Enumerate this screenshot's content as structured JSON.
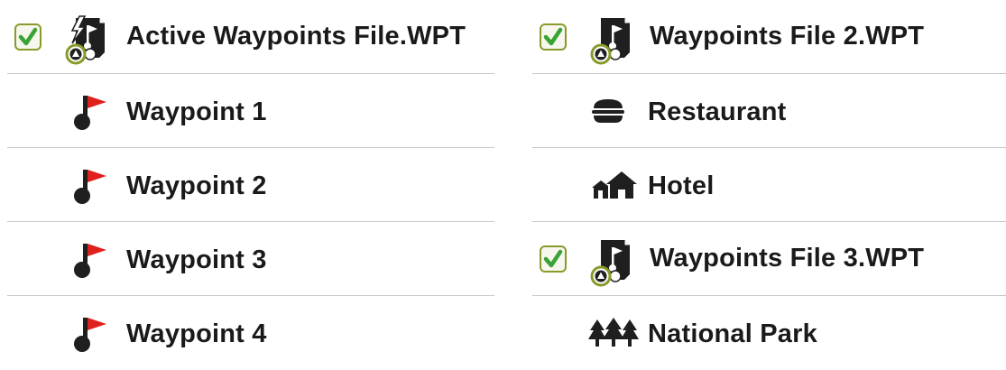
{
  "left_column": {
    "file": {
      "label": "Active Waypoints File.WPT",
      "checked": true,
      "icon": "active-waypoints-file-icon"
    },
    "items": [
      {
        "label": "Waypoint 1",
        "icon": "red-flag-waypoint-icon"
      },
      {
        "label": "Waypoint 2",
        "icon": "red-flag-waypoint-icon"
      },
      {
        "label": "Waypoint 3",
        "icon": "red-flag-waypoint-icon"
      },
      {
        "label": "Waypoint 4",
        "icon": "red-flag-waypoint-icon"
      }
    ]
  },
  "right_column": {
    "rows": [
      {
        "type": "file",
        "label": "Waypoints File 2.WPT",
        "checked": true,
        "icon": "waypoints-file-icon"
      },
      {
        "type": "item",
        "label": "Restaurant",
        "icon": "restaurant-icon"
      },
      {
        "type": "item",
        "label": "Hotel",
        "icon": "hotel-icon"
      },
      {
        "type": "file",
        "label": "Waypoints File 3.WPT",
        "checked": true,
        "icon": "waypoints-file-icon"
      },
      {
        "type": "item",
        "label": "National Park",
        "icon": "national-park-icon"
      }
    ]
  },
  "colors": {
    "checkbox_border": "#8a9a2a",
    "checkmark": "#3aa335",
    "flag": "#e0201c",
    "divider": "#c9c9c9",
    "text": "#1a1a1a"
  }
}
